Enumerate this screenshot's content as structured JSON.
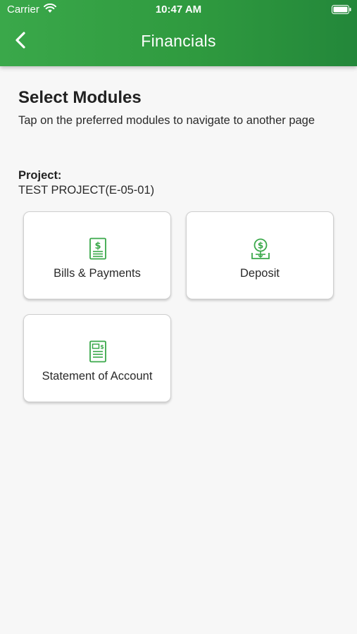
{
  "status_bar": {
    "carrier": "Carrier",
    "time": "10:47 AM"
  },
  "header": {
    "title": "Financials",
    "back_icon": "chevron-left-icon"
  },
  "main": {
    "section_title": "Select Modules",
    "section_description": "Tap on the preferred modules to navigate to another page",
    "project_label": "Project:",
    "project_value": "TEST PROJECT(E-05-01)"
  },
  "modules": [
    {
      "label": "Bills & Payments",
      "icon": "bill-icon"
    },
    {
      "label": "Deposit",
      "icon": "deposit-icon"
    },
    {
      "label": "Statement of Account",
      "icon": "statement-icon"
    }
  ],
  "colors": {
    "header_green": "#2f9a3f",
    "icon_green": "#3aa84a",
    "background": "#f7f7f7"
  }
}
